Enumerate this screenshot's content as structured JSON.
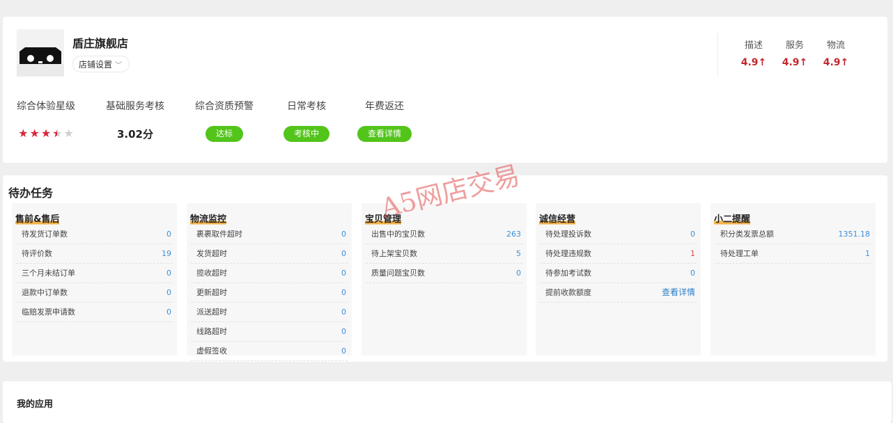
{
  "shop": {
    "name": "盾庄旗舰店",
    "settings_label": "店铺设置",
    "ratings": [
      {
        "label": "描述",
        "value": "4.9↑"
      },
      {
        "label": "服务",
        "value": "4.9↑"
      },
      {
        "label": "物流",
        "value": "4.9↑"
      }
    ],
    "metrics": [
      {
        "label": "综合体验星级",
        "stars": 3.5,
        "max_stars": 5
      },
      {
        "label": "基础服务考核",
        "value": "3.02分"
      },
      {
        "label": "综合资质预警",
        "badge": "达标"
      },
      {
        "label": "日常考核",
        "badge": "考核中"
      },
      {
        "label": "年费返还",
        "badge": "查看详情"
      }
    ]
  },
  "tasks": {
    "title": "待办任务",
    "panels": [
      {
        "title": "售前&售后",
        "items": [
          {
            "label": "待发货订单数",
            "value": "0"
          },
          {
            "label": "待评价数",
            "value": "19"
          },
          {
            "label": "三个月未结订单",
            "value": "0"
          },
          {
            "label": "退款中订单数",
            "value": "0"
          },
          {
            "label": "临赔发票申请数",
            "value": "0"
          }
        ]
      },
      {
        "title": "物流监控",
        "items": [
          {
            "label": "裹裹取件超时",
            "value": "0"
          },
          {
            "label": "发货超时",
            "value": "0"
          },
          {
            "label": "揽收超时",
            "value": "0"
          },
          {
            "label": "更新超时",
            "value": "0"
          },
          {
            "label": "派送超时",
            "value": "0"
          },
          {
            "label": "线路超时",
            "value": "0"
          },
          {
            "label": "虚假签收",
            "value": "0"
          }
        ]
      },
      {
        "title": "宝贝管理",
        "items": [
          {
            "label": "出售中的宝贝数",
            "value": "263"
          },
          {
            "label": "待上架宝贝数",
            "value": "5"
          },
          {
            "label": "质量问题宝贝数",
            "value": "0"
          }
        ]
      },
      {
        "title": "诚信经营",
        "items": [
          {
            "label": "待处理投诉数",
            "value": "0"
          },
          {
            "label": "待处理违规数",
            "value": "1"
          },
          {
            "label": "待参加考试数",
            "value": "0"
          },
          {
            "label": "提前收款额度",
            "value": "查看详情"
          }
        ]
      },
      {
        "title": "小二提醒",
        "items": [
          {
            "label": "积分类发票总额",
            "value": "1351.18"
          },
          {
            "label": "待处理工单",
            "value": "1"
          }
        ]
      }
    ]
  },
  "apps": {
    "title": "我的应用"
  },
  "watermark": "A5网店交易",
  "colors": {
    "accent_red": "#c1282d",
    "badge_green": "#52c41a",
    "link_blue": "#3c8ed8",
    "underline_orange": "#f3b24a"
  }
}
